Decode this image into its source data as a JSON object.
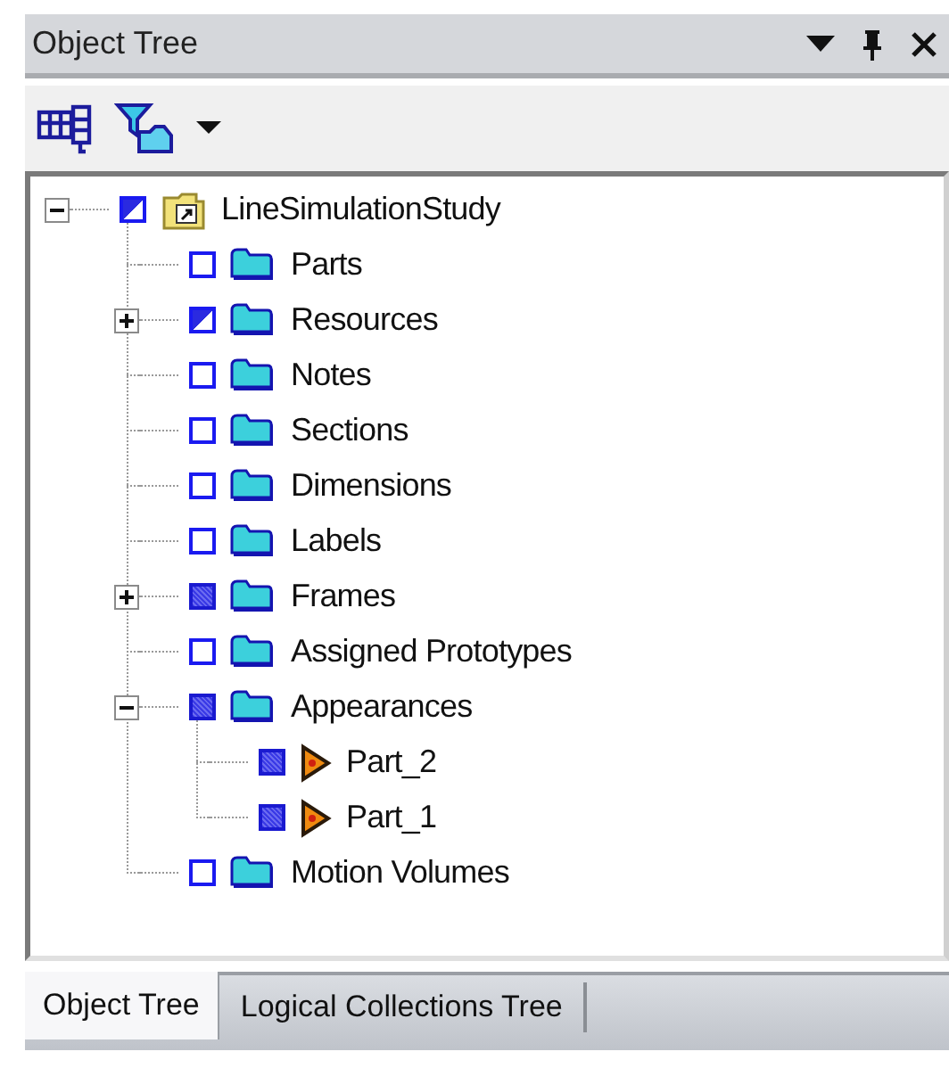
{
  "panel": {
    "title": "Object Tree"
  },
  "tree": [
    {
      "label": "LineSimulationStudy",
      "checked": true,
      "partial": true,
      "kind": "study",
      "expanded": true,
      "children": [
        {
          "label": "Parts",
          "checked": false,
          "partial": false,
          "kind": "folder"
        },
        {
          "label": "Resources",
          "checked": true,
          "partial": true,
          "kind": "folder",
          "expanded": false
        },
        {
          "label": "Notes",
          "checked": false,
          "partial": false,
          "kind": "folder"
        },
        {
          "label": "Sections",
          "checked": false,
          "partial": false,
          "kind": "folder"
        },
        {
          "label": "Dimensions",
          "checked": false,
          "partial": false,
          "kind": "folder"
        },
        {
          "label": "Labels",
          "checked": false,
          "partial": false,
          "kind": "folder"
        },
        {
          "label": "Frames",
          "checked": true,
          "partial": false,
          "kind": "folder",
          "expanded": false
        },
        {
          "label": "Assigned Prototypes",
          "checked": false,
          "partial": false,
          "kind": "folder"
        },
        {
          "label": "Appearances",
          "checked": true,
          "partial": false,
          "kind": "folder",
          "expanded": true,
          "children": [
            {
              "label": "Part_2",
              "checked": true,
              "partial": false,
              "kind": "part"
            },
            {
              "label": "Part_1",
              "checked": true,
              "partial": false,
              "kind": "part"
            }
          ]
        },
        {
          "label": "Motion Volumes",
          "checked": false,
          "partial": false,
          "kind": "folder"
        }
      ]
    }
  ],
  "tabs": [
    {
      "label": "Object Tree",
      "selected": true
    },
    {
      "label": "Logical Collections Tree",
      "selected": false
    }
  ]
}
